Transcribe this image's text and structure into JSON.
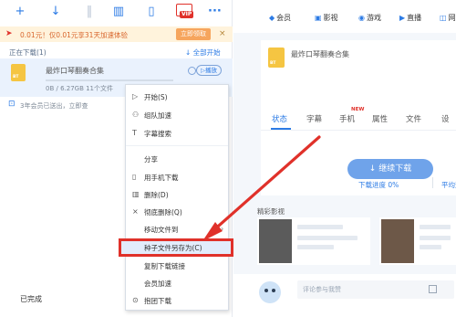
{
  "toolbar": {
    "icons": [
      "add-icon",
      "download-icon",
      "pause-icon",
      "delete-icon",
      "phone-icon",
      "vip-icon",
      "more-icon"
    ],
    "vip_label": "VIP",
    "more": "···"
  },
  "promo": {
    "text": "0.01元！仅0.01元享31天加速体验",
    "button": "立即领取",
    "close": "×"
  },
  "downloading": {
    "header": "正在下载(1)",
    "all_start": "↓ 全部开始"
  },
  "task": {
    "name": "最炸口琴翻奏合集",
    "meta": "0B / 6.27GB 11个文件",
    "play": "▷播放",
    "file_type": "BT"
  },
  "promo2": {
    "text": "3年会员已送出，立即查"
  },
  "completed": "已完成",
  "topnav": [
    {
      "icon": "◆",
      "label": "会员"
    },
    {
      "icon": "▣",
      "label": "影视"
    },
    {
      "icon": "◉",
      "label": "游戏"
    },
    {
      "icon": "▶",
      "label": "直播"
    },
    {
      "icon": "◫",
      "label": "网"
    }
  ],
  "detail": {
    "title": "最炸口琴翻奏合集",
    "file_type": "BT",
    "tabs": [
      "状态",
      "字幕",
      "手机",
      "属性",
      "文件",
      "设"
    ],
    "new_badge": "NEW",
    "continue_button": "↓  继续下载",
    "progress": "下载进度 0%",
    "avg_speed": "平均速度"
  },
  "section": "精彩影视",
  "comment": {
    "placeholder": "评论参与我赞"
  },
  "context_menu": {
    "items": [
      {
        "icon": "▷",
        "label": "开始(S)"
      },
      {
        "icon": "",
        "label": "组队加速"
      },
      {
        "icon": "T",
        "label": "字幕搜索"
      },
      {
        "icon": "",
        "label": "分享"
      },
      {
        "icon": "▯",
        "label": "用手机下载"
      },
      {
        "icon": "▥",
        "label": "删除(D)"
      },
      {
        "icon": "×",
        "label": "彻底删除(Q)"
      },
      {
        "icon": "",
        "label": "移动文件到",
        "arrow": "›"
      },
      {
        "icon": "",
        "label": "种子文件另存为(C)"
      },
      {
        "icon": "",
        "label": "复制下载链接"
      },
      {
        "icon": "",
        "label": "会员加速"
      },
      {
        "icon": "⊙",
        "label": "抱团下载"
      }
    ]
  },
  "colors": {
    "accent": "#2c7be5",
    "highlight_border": "#e0312a",
    "promo_bg": "#fff3dc",
    "promo_button": "#f6a55d"
  }
}
